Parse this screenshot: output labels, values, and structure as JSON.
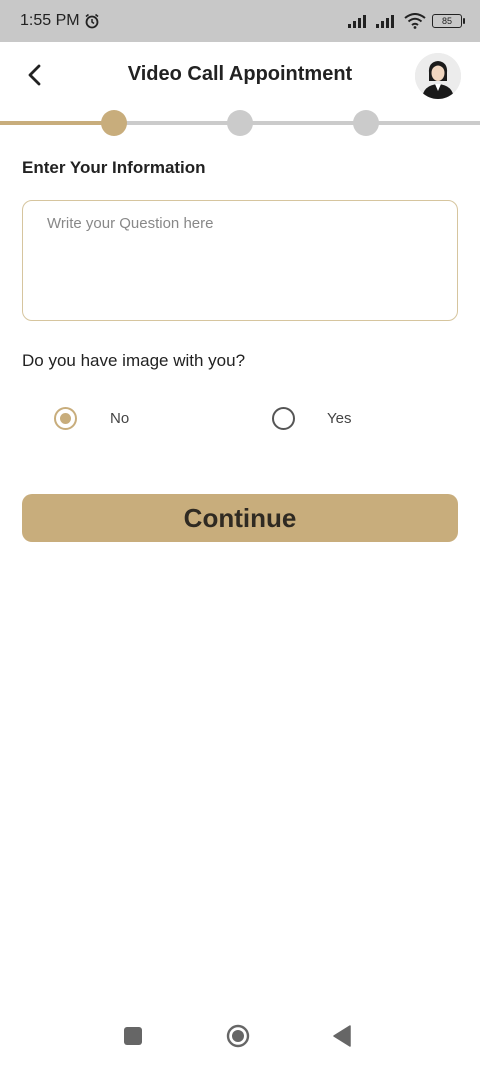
{
  "status_bar": {
    "time": "1:55 PM",
    "battery": "85"
  },
  "header": {
    "title": "Video Call Appointment"
  },
  "stepper": {
    "steps": 3,
    "current_step": 1
  },
  "form": {
    "section_title": "Enter Your Information",
    "question_placeholder": "Write your Question here",
    "question_value": "",
    "image_question": "Do you have image with you?",
    "options": [
      {
        "label": "No",
        "selected": true
      },
      {
        "label": "Yes",
        "selected": false
      }
    ],
    "continue_label": "Continue"
  },
  "colors": {
    "accent": "#c8ad7c",
    "inactive_step": "#cbcbcb",
    "status_bar_bg": "#c8c8c8"
  }
}
